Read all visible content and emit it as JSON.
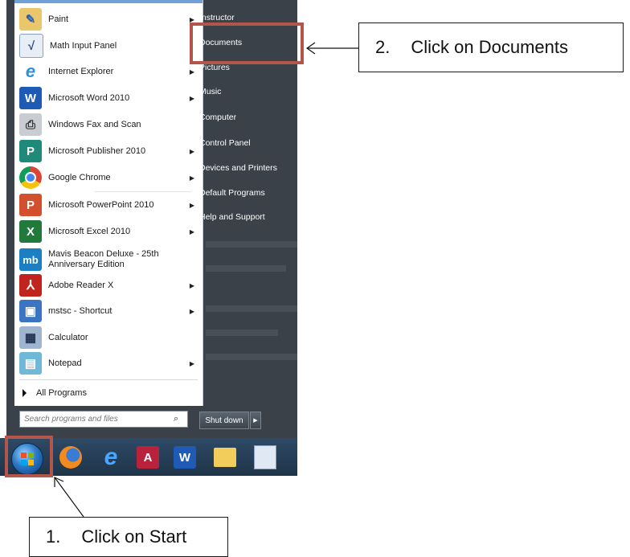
{
  "start_menu": {
    "programs": [
      {
        "label": "Paint",
        "icon": "paint-icon",
        "arrow": true
      },
      {
        "label": "Math Input Panel",
        "icon": "math-input-panel-icon",
        "arrow": false
      },
      {
        "label": "Internet Explorer",
        "icon": "internet-explorer-icon",
        "arrow": true
      },
      {
        "label": "Microsoft Word 2010",
        "icon": "word-icon",
        "arrow": true
      },
      {
        "label": "Windows Fax and Scan",
        "icon": "fax-scan-icon",
        "arrow": false
      },
      {
        "label": "Microsoft Publisher 2010",
        "icon": "publisher-icon",
        "arrow": true
      },
      {
        "label": "Google Chrome",
        "icon": "chrome-icon",
        "arrow": true
      },
      {
        "label": "Microsoft PowerPoint 2010",
        "icon": "powerpoint-icon",
        "arrow": true
      },
      {
        "label": "Microsoft Excel 2010",
        "icon": "excel-icon",
        "arrow": true
      },
      {
        "label": "Mavis Beacon Deluxe - 25th Anniversary Edition",
        "icon": "mavis-beacon-icon",
        "arrow": false
      },
      {
        "label": "Adobe Reader X",
        "icon": "adobe-reader-icon",
        "arrow": true
      },
      {
        "label": "mstsc - Shortcut",
        "icon": "remote-desktop-icon",
        "arrow": true
      },
      {
        "label": "Calculator",
        "icon": "calculator-icon",
        "arrow": false
      },
      {
        "label": "Notepad",
        "icon": "notepad-icon",
        "arrow": true
      }
    ],
    "all_programs": "All Programs",
    "search_placeholder": "Search programs and files",
    "right_links": [
      "Instructor",
      "Documents",
      "Pictures",
      "Music",
      "Computer",
      "Control Panel",
      "Devices and Printers",
      "Default Programs",
      "Help and Support"
    ],
    "shutdown_label": "Shut down"
  },
  "callouts": {
    "documents": {
      "number": "2.",
      "text": "Click on Documents"
    },
    "start": {
      "number": "1.",
      "text": "Click on Start"
    }
  },
  "colors": {
    "highlight": "#b2564c",
    "menu_dark": "#3a4148",
    "taskbar": "#1f3448"
  }
}
